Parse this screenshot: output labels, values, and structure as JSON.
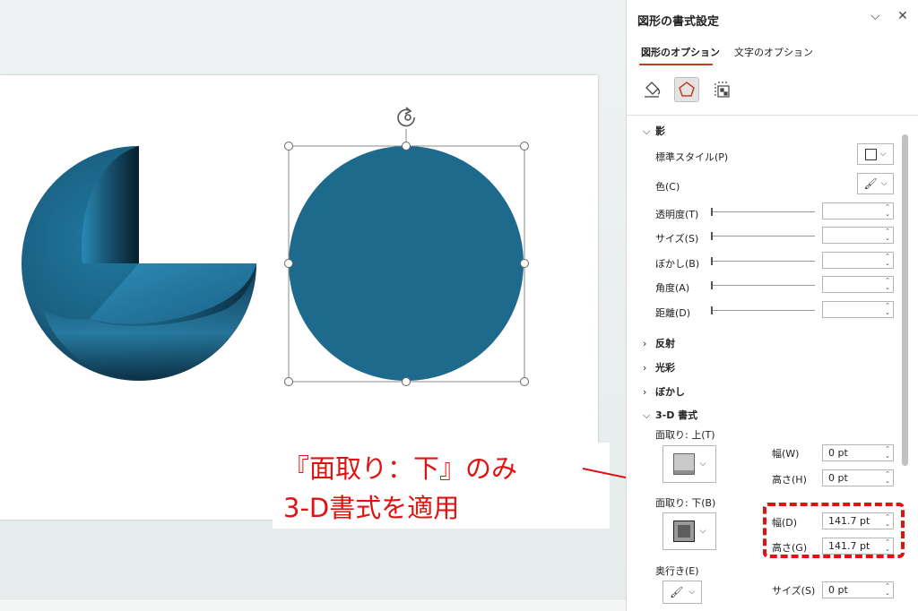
{
  "panel": {
    "title": "図形の書式設定",
    "tabs": [
      {
        "label": "図形のオプション"
      },
      {
        "label": "文字のオプション"
      }
    ],
    "icons": [
      "fill-line-icon",
      "effects-icon",
      "size-properties-icon"
    ]
  },
  "shadow": {
    "header": "影",
    "preset_label": "標準スタイル(P)",
    "color_label": "色(C)",
    "rows": [
      {
        "label": "透明度(T)",
        "value": ""
      },
      {
        "label": "サイズ(S)",
        "value": ""
      },
      {
        "label": "ぼかし(B)",
        "value": ""
      },
      {
        "label": "角度(A)",
        "value": ""
      },
      {
        "label": "距離(D)",
        "value": ""
      }
    ]
  },
  "sections": {
    "reflection": "反射",
    "glow": "光彩",
    "soft_edges": "ぼかし",
    "format3d": "3-D 書式"
  },
  "format3d": {
    "top_bevel_label": "面取り: 上(T)",
    "top_width_label": "幅(W)",
    "top_width_value": "0 pt",
    "top_height_label": "高さ(H)",
    "top_height_value": "0 pt",
    "bottom_bevel_label": "面取り: 下(B)",
    "bottom_width_label": "幅(D)",
    "bottom_width_value": "141.7 pt",
    "bottom_height_label": "高さ(G)",
    "bottom_height_value": "141.7 pt",
    "depth_label": "奥行き(E)",
    "depth_size_label": "サイズ(S)",
    "depth_size_value": "0 pt"
  },
  "callout": {
    "line1": "『面取り：下』のみ",
    "line2": "3-D書式を適用",
    "color": "#e01212"
  },
  "colors": {
    "shape_fill": "#1d6a8c",
    "accent": "#c43e1c"
  }
}
